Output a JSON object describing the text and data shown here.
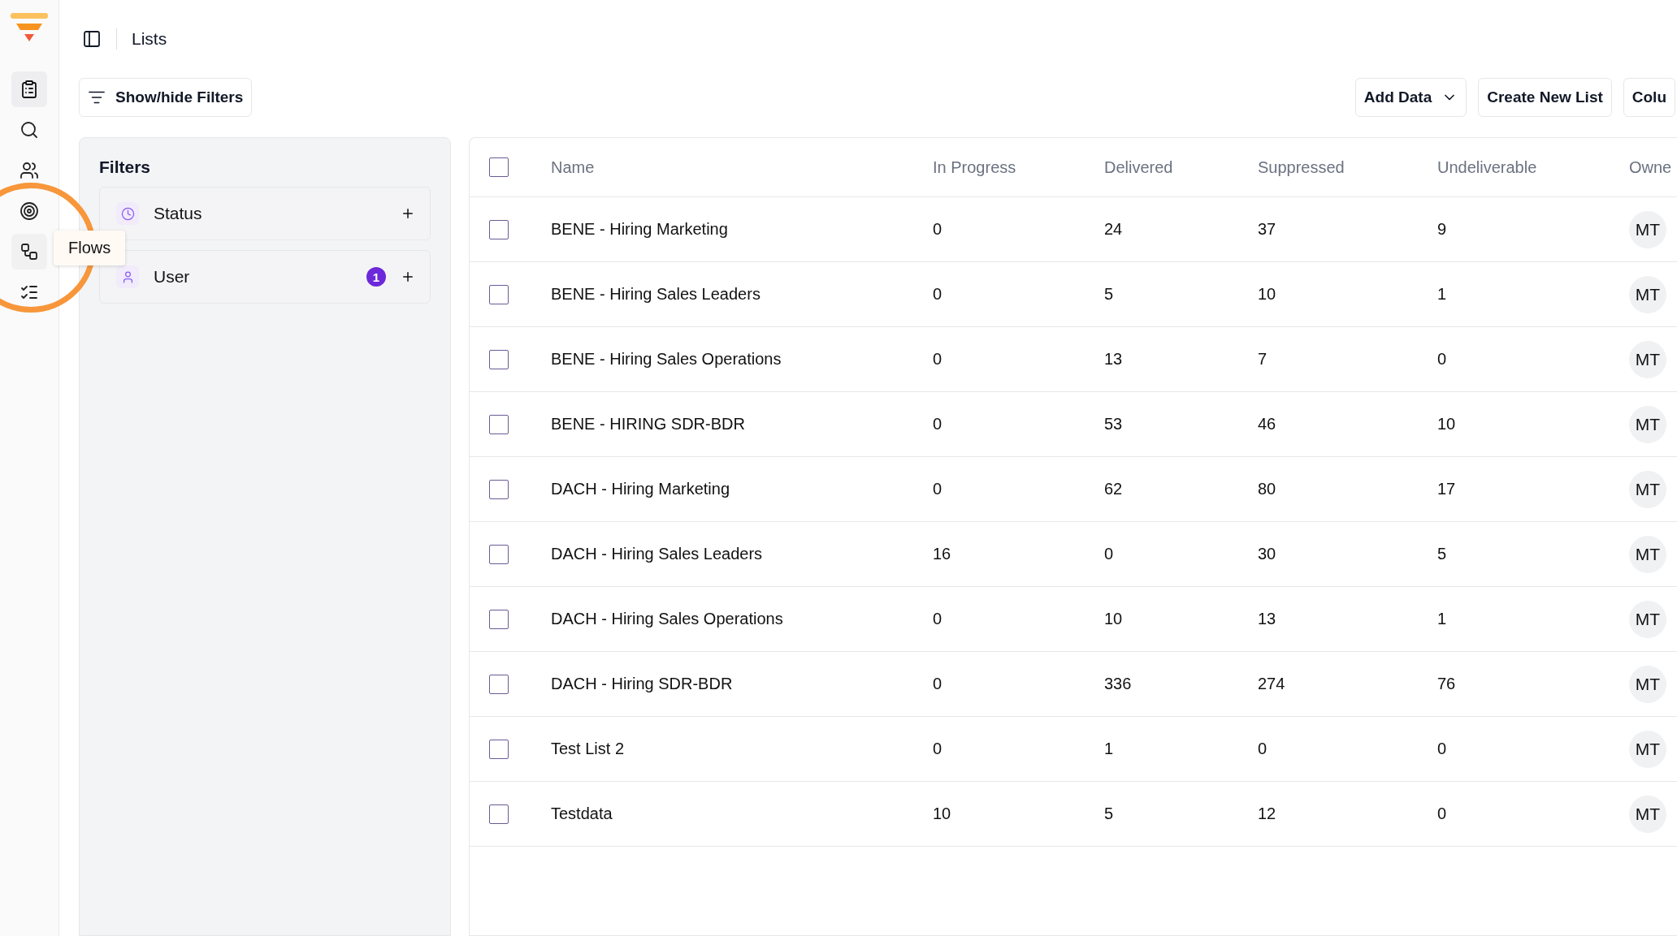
{
  "sidebar": {
    "items": [
      {
        "selected": true
      },
      {
        "selected": false
      },
      {
        "selected": false
      },
      {
        "selected": false
      },
      {
        "selected": false,
        "hovered": true,
        "tooltip": "Flows"
      },
      {
        "selected": false
      }
    ],
    "highlight": true
  },
  "header": {
    "title": "Lists"
  },
  "toolbar": {
    "filter_toggle": "Show/hide Filters",
    "buttons": [
      {
        "label": "Add Data",
        "kind": "dropdown"
      },
      {
        "label": "Create New List",
        "kind": "plain"
      },
      {
        "label": "Colu",
        "kind": "plain"
      }
    ]
  },
  "filters": {
    "title": "Filters",
    "items": [
      {
        "label": "Status",
        "kind": "status"
      },
      {
        "label": "User",
        "kind": "user",
        "count": "1"
      }
    ]
  },
  "table": {
    "select_all": false,
    "columns": [
      "Name",
      "In Progress",
      "Delivered",
      "Suppressed",
      "Undeliverable",
      "Owne"
    ],
    "rows": [
      {
        "checked": false,
        "cells": [
          "BENE - Hiring Marketing",
          "0",
          "24",
          "37",
          "9",
          "MT"
        ]
      },
      {
        "checked": false,
        "cells": [
          "BENE - Hiring Sales Leaders",
          "0",
          "5",
          "10",
          "1",
          "MT"
        ]
      },
      {
        "checked": false,
        "cells": [
          "BENE - Hiring Sales Operations",
          "0",
          "13",
          "7",
          "0",
          "MT"
        ]
      },
      {
        "checked": false,
        "cells": [
          "BENE - HIRING SDR-BDR",
          "0",
          "53",
          "46",
          "10",
          "MT"
        ]
      },
      {
        "checked": false,
        "cells": [
          "DACH - Hiring Marketing",
          "0",
          "62",
          "80",
          "17",
          "MT"
        ]
      },
      {
        "checked": false,
        "cells": [
          "DACH - Hiring Sales Leaders",
          "16",
          "0",
          "30",
          "5",
          "MT"
        ]
      },
      {
        "checked": false,
        "cells": [
          "DACH - Hiring Sales Operations",
          "0",
          "10",
          "13",
          "1",
          "MT"
        ]
      },
      {
        "checked": false,
        "cells": [
          "DACH - Hiring SDR-BDR",
          "0",
          "336",
          "274",
          "76",
          "MT"
        ]
      },
      {
        "checked": false,
        "cells": [
          "Test List 2",
          "0",
          "1",
          "0",
          "0",
          "MT"
        ]
      },
      {
        "checked": false,
        "cells": [
          "Testdata",
          "10",
          "5",
          "12",
          "0",
          "MT"
        ]
      }
    ]
  }
}
